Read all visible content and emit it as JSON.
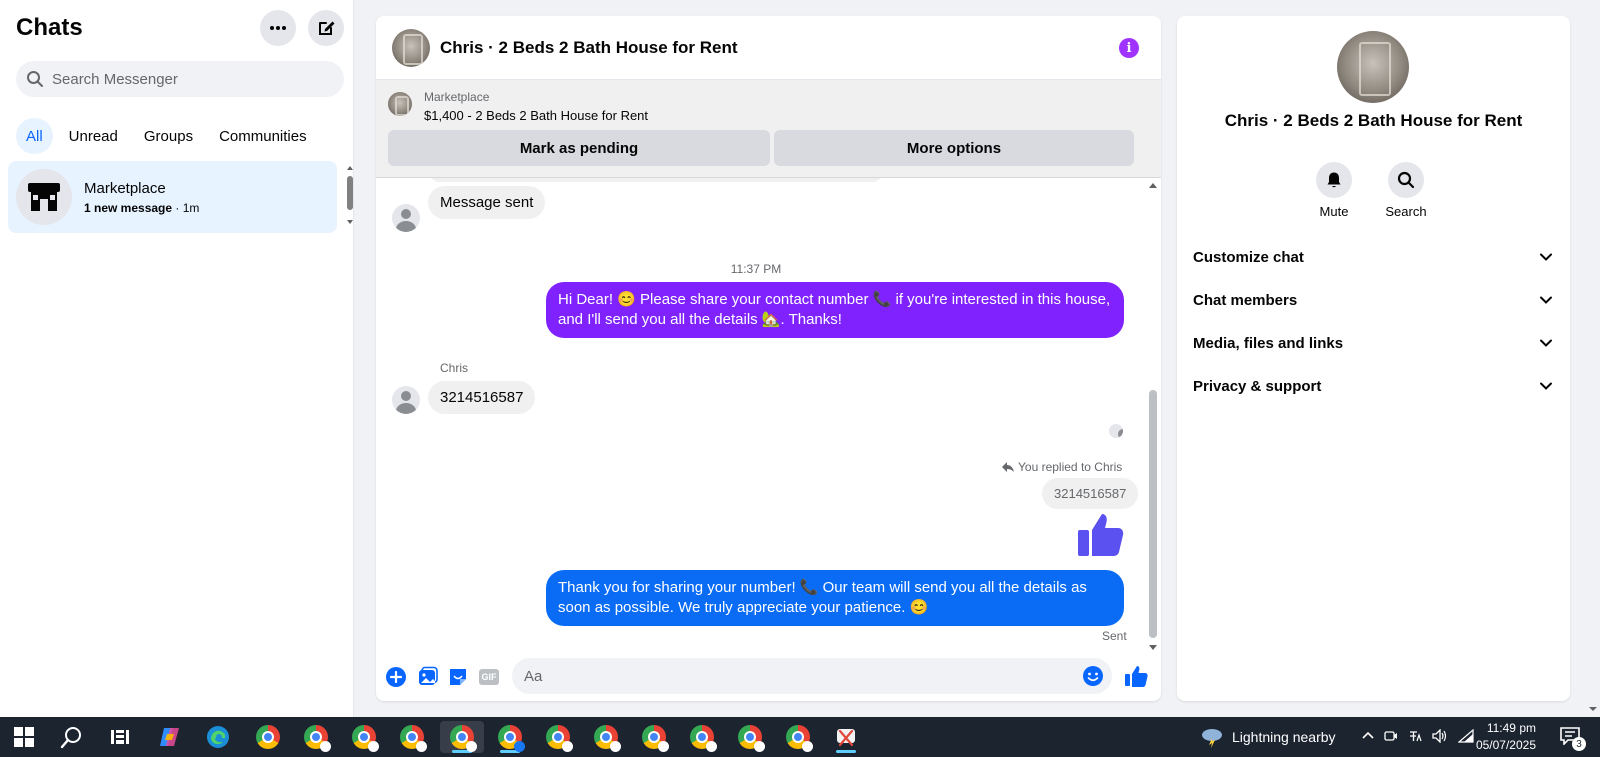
{
  "sidebar": {
    "title": "Chats",
    "search_placeholder": "Search Messenger",
    "filters": [
      "All",
      "Unread",
      "Groups",
      "Communities"
    ],
    "chat_item": {
      "name": "Marketplace",
      "sub_bold": "1 new message",
      "sub_time": " · 1m"
    }
  },
  "header": {
    "title": "Chris · 2 Beds 2 Bath House for Rent"
  },
  "marketplace": {
    "label": "Marketplace",
    "item": "$1,400 - 2 Beds 2 Bath House for Rent",
    "pending_button": "Mark as pending",
    "options_button": "More options"
  },
  "messages": {
    "message_sent": "Message sent",
    "timestamp": "11:37 PM",
    "outgoing_1": "Hi Dear! 😊 Please share your contact number 📞 if you're interested in this house, and I'll send you all the details 🏡. Thanks!",
    "sender": "Chris",
    "incoming_1": "3214516587",
    "reply_note": "You replied to Chris",
    "reply_quote": "3214516587",
    "outgoing_2": "Thank you for sharing your number! 📞 Our team will send you all the details as soon as possible. We truly appreciate your patience. 😊",
    "status": "Sent"
  },
  "composer": {
    "placeholder": "Aa",
    "gif_label": "GIF"
  },
  "info_panel": {
    "name": "Chris · 2 Beds 2 Bath House for Rent",
    "actions": [
      "Mute",
      "Search"
    ],
    "sections": [
      "Customize chat",
      "Chat members",
      "Media, files and links",
      "Privacy & support"
    ]
  },
  "taskbar": {
    "weather": "Lightning nearby",
    "time": "11:49 pm",
    "date": "05/07/2025",
    "notifications": "3",
    "apps": [
      "start",
      "search",
      "task-view",
      "copilot",
      "edge",
      "chrome",
      "chrome",
      "chrome",
      "chrome",
      "chrome",
      "chrome",
      "chrome",
      "chrome",
      "chrome",
      "chrome",
      "chrome",
      "chrome",
      "snipping-tool"
    ]
  },
  "colors": {
    "accent": "#0866ff",
    "purple_bubble": "#7f22fe",
    "blue_bubble": "#0a6cf5",
    "info_icon": "#a033ff",
    "thumbs_up_sticker": "#5b50f0"
  }
}
